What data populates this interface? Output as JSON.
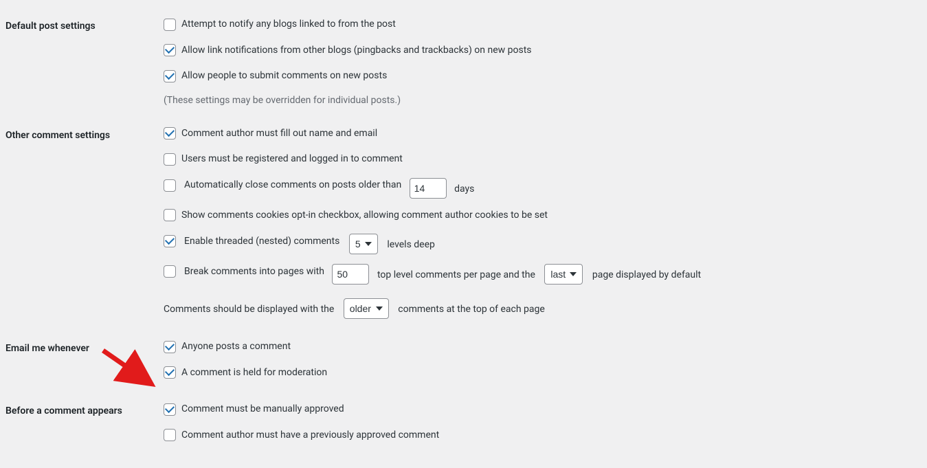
{
  "sections": {
    "default_post": {
      "heading": "Default post settings",
      "notify": {
        "label": "Attempt to notify any blogs linked to from the post",
        "checked": false
      },
      "pingback": {
        "label": "Allow link notifications from other blogs (pingbacks and trackbacks) on new posts",
        "checked": true
      },
      "allow_comments": {
        "label": "Allow people to submit comments on new posts",
        "checked": true
      },
      "note": "(These settings may be overridden for individual posts.)"
    },
    "other": {
      "heading": "Other comment settings",
      "name_email": {
        "label": "Comment author must fill out name and email",
        "checked": true
      },
      "registered": {
        "label": "Users must be registered and logged in to comment",
        "checked": false
      },
      "auto_close": {
        "label_before": "Automatically close comments on posts older than",
        "value": "14",
        "label_after": "days",
        "checked": false
      },
      "cookies": {
        "label": "Show comments cookies opt-in checkbox, allowing comment author cookies to be set",
        "checked": false
      },
      "threaded": {
        "label_before": "Enable threaded (nested) comments",
        "value": "5",
        "label_after": "levels deep",
        "checked": true
      },
      "page_comments": {
        "label_before": "Break comments into pages with",
        "per_page": "50",
        "label_mid": "top level comments per page and the",
        "default_page": "last",
        "label_after": "page displayed by default",
        "checked": false
      },
      "order": {
        "label_before": "Comments should be displayed with the",
        "value": "older",
        "label_after": "comments at the top of each page"
      }
    },
    "email": {
      "heading": "Email me whenever",
      "anyone_posts": {
        "label": "Anyone posts a comment",
        "checked": true
      },
      "held": {
        "label": "A comment is held for moderation",
        "checked": true
      }
    },
    "before": {
      "heading": "Before a comment appears",
      "manual": {
        "label": "Comment must be manually approved",
        "checked": true
      },
      "previously": {
        "label": "Comment author must have a previously approved comment",
        "checked": false
      }
    }
  }
}
